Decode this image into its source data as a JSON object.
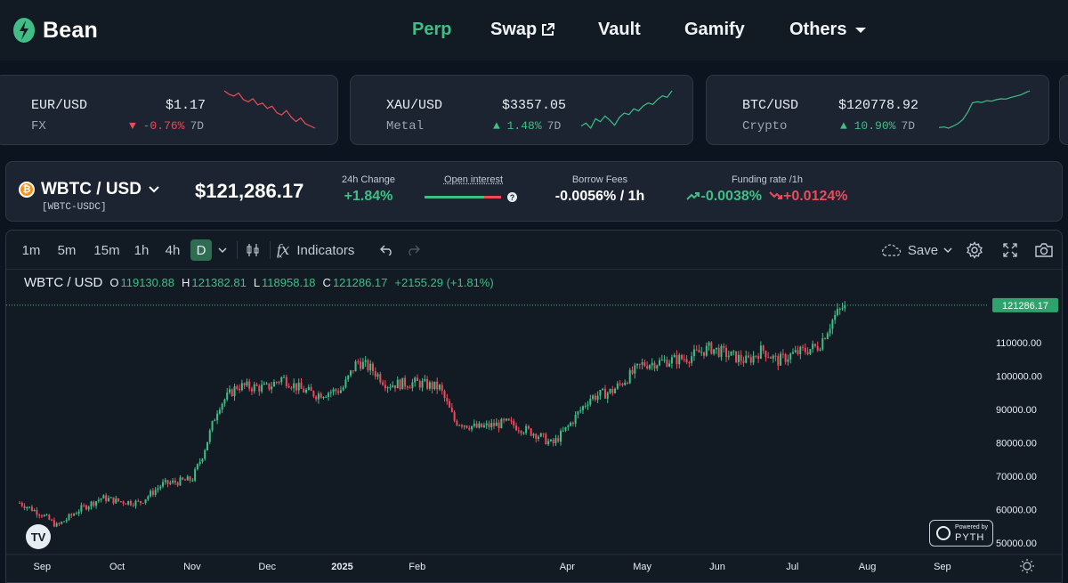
{
  "nav": {
    "brand": "Bean",
    "items": [
      {
        "label": "Perp",
        "active": true
      },
      {
        "label": "Swap",
        "external": true
      },
      {
        "label": "Vault"
      },
      {
        "label": "Gamify"
      },
      {
        "label": "Others",
        "dropdown": true
      }
    ]
  },
  "tickers": [
    {
      "symbol": "EUR/USD",
      "category": "FX",
      "price": "$1.17",
      "change": "-0.76%",
      "direction": "down",
      "period": "7D",
      "spark": [
        1.175,
        1.1742,
        1.1738,
        1.1745,
        1.173,
        1.1725,
        1.1732,
        1.1718,
        1.1722,
        1.171,
        1.1715,
        1.17,
        1.1695,
        1.1705,
        1.169,
        1.168,
        1.1688,
        1.1675,
        1.167,
        1.1665
      ]
    },
    {
      "symbol": "XAU/USD",
      "category": "Metal",
      "price": "$3357.05",
      "change": "1.48%",
      "direction": "up",
      "period": "7D",
      "spark": [
        3308,
        3312,
        3305,
        3318,
        3314,
        3322,
        3316,
        3309,
        3320,
        3326,
        3324,
        3332,
        3329,
        3336,
        3340,
        3338,
        3345,
        3350,
        3348,
        3357
      ]
    },
    {
      "symbol": "BTC/USD",
      "category": "Crypto",
      "price": "$120778.92",
      "change": "10.90%",
      "direction": "up",
      "period": "7D",
      "spark": [
        108900,
        109100,
        108700,
        109400,
        110200,
        111500,
        113800,
        116900,
        117200,
        117000,
        117600,
        117400,
        117900,
        118200,
        118100,
        118600,
        119000,
        119400,
        120100,
        120778
      ]
    }
  ],
  "pair": {
    "name": "WBTC / USD",
    "sub": "[WBTC-USDC]",
    "price": "$121,286.17",
    "change_24h_label": "24h Change",
    "change_24h": "+1.84%",
    "open_interest_label": "Open interest",
    "open_interest_long_fraction": 0.78,
    "borrow_label": "Borrow Fees",
    "borrow": "-0.0056% / 1h",
    "funding_label": "Funding rate /1h",
    "funding_long": "-0.0038%",
    "funding_short": "+0.0124%"
  },
  "toolbar": {
    "intervals": [
      "1m",
      "5m",
      "15m",
      "1h",
      "4h",
      "D"
    ],
    "active_interval": "D",
    "indicators": "Indicators",
    "save": "Save"
  },
  "ohlc": {
    "title": "WBTC / USD",
    "o_key": "O",
    "o": "119130.88",
    "h_key": "H",
    "h": "121382.81",
    "l_key": "L",
    "l": "118958.18",
    "c_key": "C",
    "c": "121286.17",
    "change": "+2155.29 (+1.81%)"
  },
  "branding": {
    "tv": "TV",
    "pyth_small": "Powered by",
    "pyth_big": "PYTH"
  },
  "chart_data": {
    "type": "candlestick",
    "series_name": "WBTC / USD",
    "ylim": [
      47000,
      125000
    ],
    "y_ticks": [
      50000,
      60000,
      70000,
      80000,
      90000,
      100000,
      110000
    ],
    "y_tick_labels": [
      "50000.00",
      "60000.00",
      "70000.00",
      "80000.00",
      "90000.00",
      "100000.00",
      "110000.00"
    ],
    "last_price": 121286.17,
    "last_price_label": "121286.17",
    "x_labels": [
      "Sep",
      "Oct",
      "Nov",
      "Dec",
      "2025",
      "Feb",
      "Apr",
      "May",
      "Jun",
      "Jul",
      "Aug",
      "Sep"
    ],
    "x_label_months": [
      0,
      1,
      2,
      3,
      4,
      5,
      7,
      8,
      9,
      10,
      11,
      12
    ],
    "bold_labels": [
      "2025"
    ],
    "months_span": [
      -0.3,
      12.5
    ],
    "monthly_anchors": [
      [
        -0.3,
        62000
      ],
      [
        0.0,
        58500
      ],
      [
        0.2,
        55000
      ],
      [
        0.5,
        60000
      ],
      [
        0.8,
        63500
      ],
      [
        1.0,
        62500
      ],
      [
        1.3,
        62000
      ],
      [
        1.6,
        67500
      ],
      [
        2.0,
        69000
      ],
      [
        2.15,
        77000
      ],
      [
        2.35,
        91000
      ],
      [
        2.6,
        97000
      ],
      [
        3.0,
        96500
      ],
      [
        3.2,
        99500
      ],
      [
        3.45,
        96000
      ],
      [
        3.65,
        94500
      ],
      [
        4.0,
        96000
      ],
      [
        4.2,
        104500
      ],
      [
        4.4,
        102000
      ],
      [
        4.6,
        97500
      ],
      [
        5.0,
        98000
      ],
      [
        5.3,
        96500
      ],
      [
        5.5,
        86500
      ],
      [
        5.8,
        84500
      ],
      [
        6.2,
        86000
      ],
      [
        6.6,
        82500
      ],
      [
        6.8,
        79500
      ],
      [
        7.0,
        84500
      ],
      [
        7.3,
        93500
      ],
      [
        7.6,
        95500
      ],
      [
        8.0,
        103500
      ],
      [
        8.3,
        104500
      ],
      [
        8.6,
        105500
      ],
      [
        8.9,
        108500
      ],
      [
        9.2,
        106000
      ],
      [
        9.4,
        104500
      ],
      [
        9.6,
        108000
      ],
      [
        9.8,
        104500
      ],
      [
        10.0,
        106500
      ],
      [
        10.35,
        109000
      ],
      [
        10.55,
        117500
      ],
      [
        10.7,
        121286
      ]
    ]
  }
}
